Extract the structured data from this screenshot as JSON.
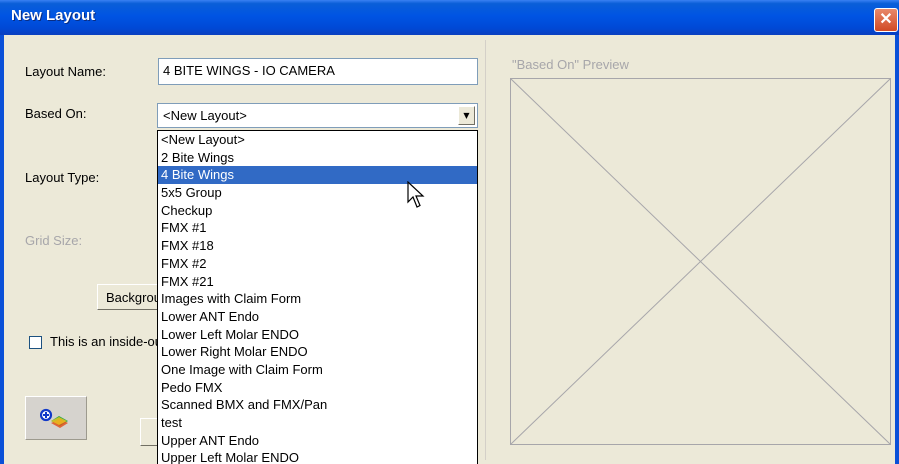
{
  "window": {
    "title": "New Layout",
    "close_glyph": "✕"
  },
  "form": {
    "layout_name_label": "Layout Name:",
    "layout_name_value": "4 BITE WINGS - IO CAMERA",
    "based_on_label": "Based On:",
    "based_on_value": "<New Layout>",
    "layout_type_label": "Layout Type:",
    "grid_size_label": "Grid Size:",
    "background_button_label": "Background...",
    "inside_checkbox_label": "This is an inside-out layout",
    "inside_checkbox_checked": false
  },
  "dropdown": {
    "selected_index": 2,
    "items": [
      "<New Layout>",
      "2 Bite Wings",
      "4 Bite Wings",
      "5x5 Group",
      "Checkup",
      "FMX #1",
      "FMX #18",
      "FMX #2",
      "FMX #21",
      "Images with Claim Form",
      "Lower ANT Endo",
      "Lower Left Molar ENDO",
      "Lower Right Molar ENDO",
      "One Image with Claim Form",
      "Pedo FMX",
      "Scanned BMX and FMX/Pan",
      "test",
      "Upper ANT Endo",
      "Upper Left Molar ENDO"
    ]
  },
  "preview": {
    "label": "\"Based On\" Preview"
  },
  "icons": {
    "tool": "add-image-tool-icon",
    "cursor": "mouse-pointer-icon"
  },
  "colors": {
    "titlebar": "#0054e3",
    "selection": "#316ac5",
    "dialog_bg": "#ece9d8"
  }
}
